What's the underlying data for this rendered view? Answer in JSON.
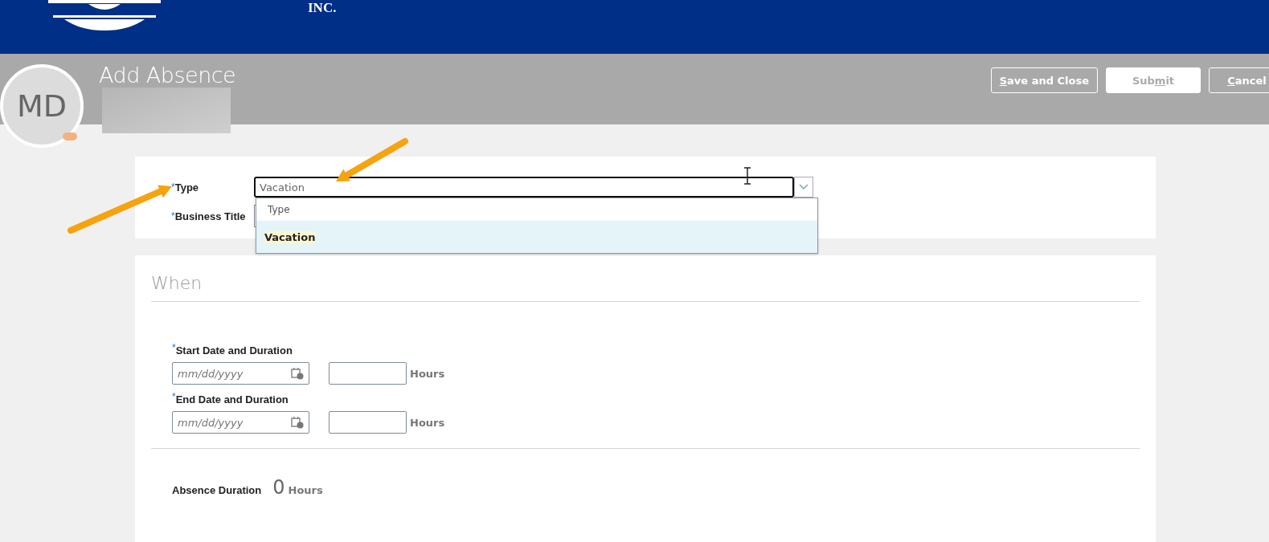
{
  "header": {
    "logo_text": "INC."
  },
  "page": {
    "title": "Add Absence",
    "avatar_initials": "MD",
    "buttons": [
      {
        "access_key": "S",
        "label_rest": "ave and Close",
        "kind": "outline"
      },
      {
        "label_start": "Sub",
        "access_key": "m",
        "label_rest": "it",
        "kind": "solid"
      },
      {
        "access_key": "C",
        "label_rest": "ancel",
        "kind": "outline"
      }
    ]
  },
  "type_field": {
    "label": "Type",
    "required_mark": "*",
    "value": "Vacation",
    "expanded": true
  },
  "dropdown": {
    "header": "Type",
    "options": [
      {
        "label": "Vacation",
        "selected": true
      }
    ]
  },
  "business_title": {
    "label": "Business Title",
    "required_mark": "*"
  },
  "when": {
    "title": "When",
    "rows": [
      {
        "label": "Start Date and Duration",
        "required_mark": "*",
        "placeholder": "mm/dd/yyyy",
        "unit": "Hours"
      },
      {
        "label": "End Date and Duration",
        "required_mark": "*",
        "placeholder": "mm/dd/yyyy",
        "unit": "Hours"
      }
    ],
    "absence_duration": {
      "label": "Absence Duration",
      "value": "0",
      "unit": "Hours"
    }
  }
}
